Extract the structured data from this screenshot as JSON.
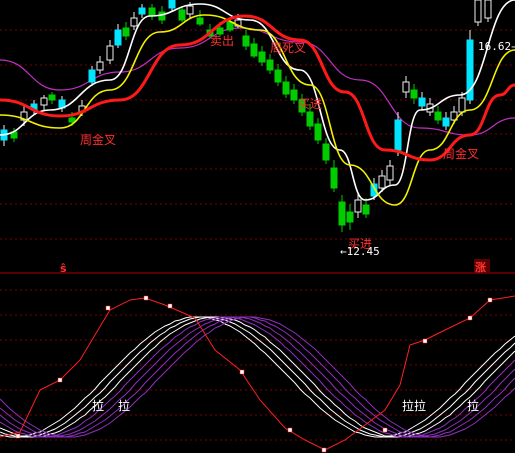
{
  "chart": {
    "colors": {
      "background": "#000000",
      "grid": "#7a0000",
      "separator": "#b00000",
      "candle_up": "#f0f0f0",
      "candle_up_fill": "#00e5ff",
      "candle_down": "#00cc00",
      "ma_white": "#ffffff",
      "ma_yellow": "#f2f200",
      "ma_red": "#ff1a1a",
      "ma_magenta": "#c030c0",
      "osc_red": "#ff2020",
      "osc_band_light": "#ffffff",
      "osc_band_purple": "#9030c0",
      "label_red": "#ff3030",
      "label_white": "#ffffff"
    },
    "price_panel": {
      "signals": [
        {
          "id": "zhou-jin-cha-1",
          "text": "周金叉"
        },
        {
          "id": "mai-chu",
          "text": "卖出"
        },
        {
          "id": "zhou-si-cha",
          "text": "周死叉"
        },
        {
          "id": "mai-jin-1",
          "text": "买进"
        },
        {
          "id": "mai-jin-2",
          "text": "买进"
        },
        {
          "id": "zhou-jin-cha-2",
          "text": "周金叉"
        }
      ],
      "low_price_label": "←12.45",
      "high_price_label": "16.62→"
    },
    "divider": {
      "left_marker": "ŝ",
      "right_marker": "涨"
    },
    "oscillator_panel": {
      "labels": [
        {
          "id": "la-1",
          "text": "拉"
        },
        {
          "id": "la-2",
          "text": "拉"
        },
        {
          "id": "la-3",
          "text": "拉拉"
        },
        {
          "id": "la-4",
          "text": "拉"
        }
      ]
    }
  }
}
